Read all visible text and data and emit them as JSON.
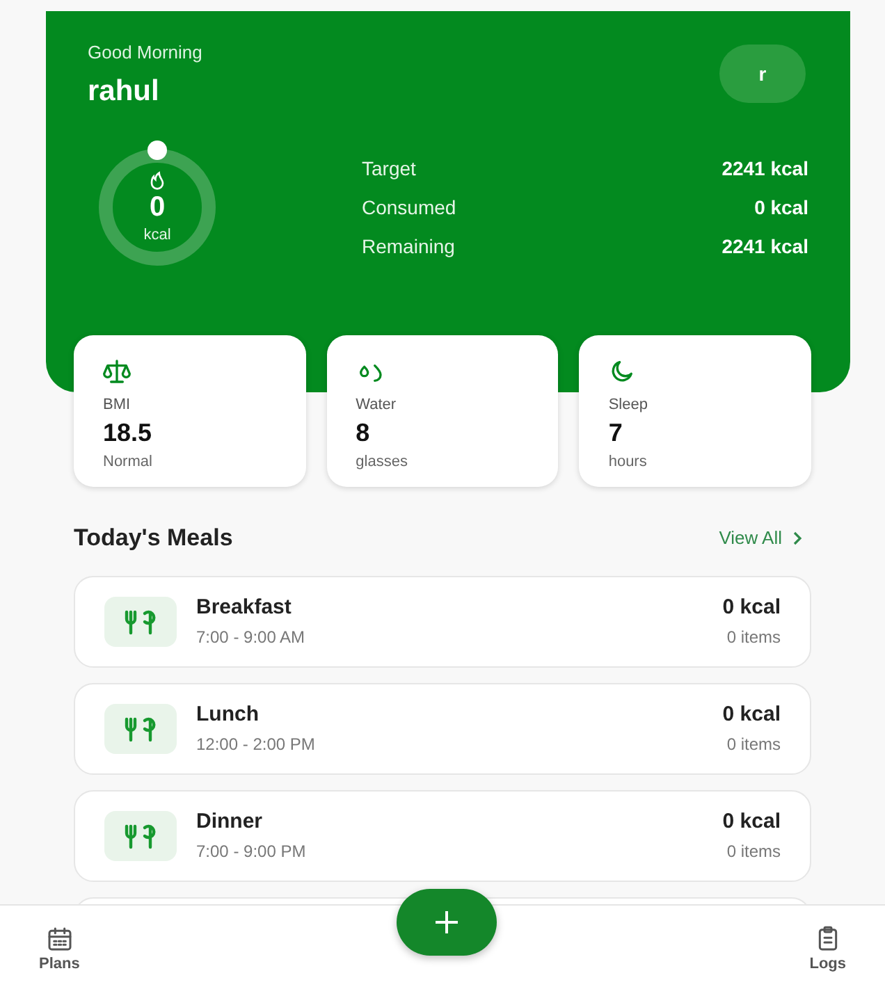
{
  "header": {
    "greeting": "Good Morning",
    "name": "rahul",
    "avatar": "r",
    "calories": {
      "value": "0",
      "unit": "kcal"
    },
    "stats": [
      {
        "label": "Target",
        "value": "2241 kcal"
      },
      {
        "label": "Consumed",
        "value": "0 kcal"
      },
      {
        "label": "Remaining",
        "value": "2241 kcal"
      }
    ]
  },
  "metrics": [
    {
      "kind": "bmi",
      "label": "BMI",
      "value": "18.5",
      "unit": "Normal"
    },
    {
      "kind": "water",
      "label": "Water",
      "value": "8",
      "unit": "glasses"
    },
    {
      "kind": "sleep",
      "label": "Sleep",
      "value": "7",
      "unit": "hours"
    }
  ],
  "meals": {
    "title": "Today's Meals",
    "view_all": "View All",
    "items": [
      {
        "name": "Breakfast",
        "time": "7:00 - 9:00 AM",
        "kcal": "0 kcal",
        "count": "0 items"
      },
      {
        "name": "Lunch",
        "time": "12:00 - 2:00 PM",
        "kcal": "0 kcal",
        "count": "0 items"
      },
      {
        "name": "Dinner",
        "time": "7:00 - 9:00 PM",
        "kcal": "0 kcal",
        "count": "0 items"
      }
    ]
  },
  "nav": [
    {
      "kind": "plans",
      "label": "Plans"
    },
    {
      "kind": "logs",
      "label": "Logs"
    }
  ]
}
